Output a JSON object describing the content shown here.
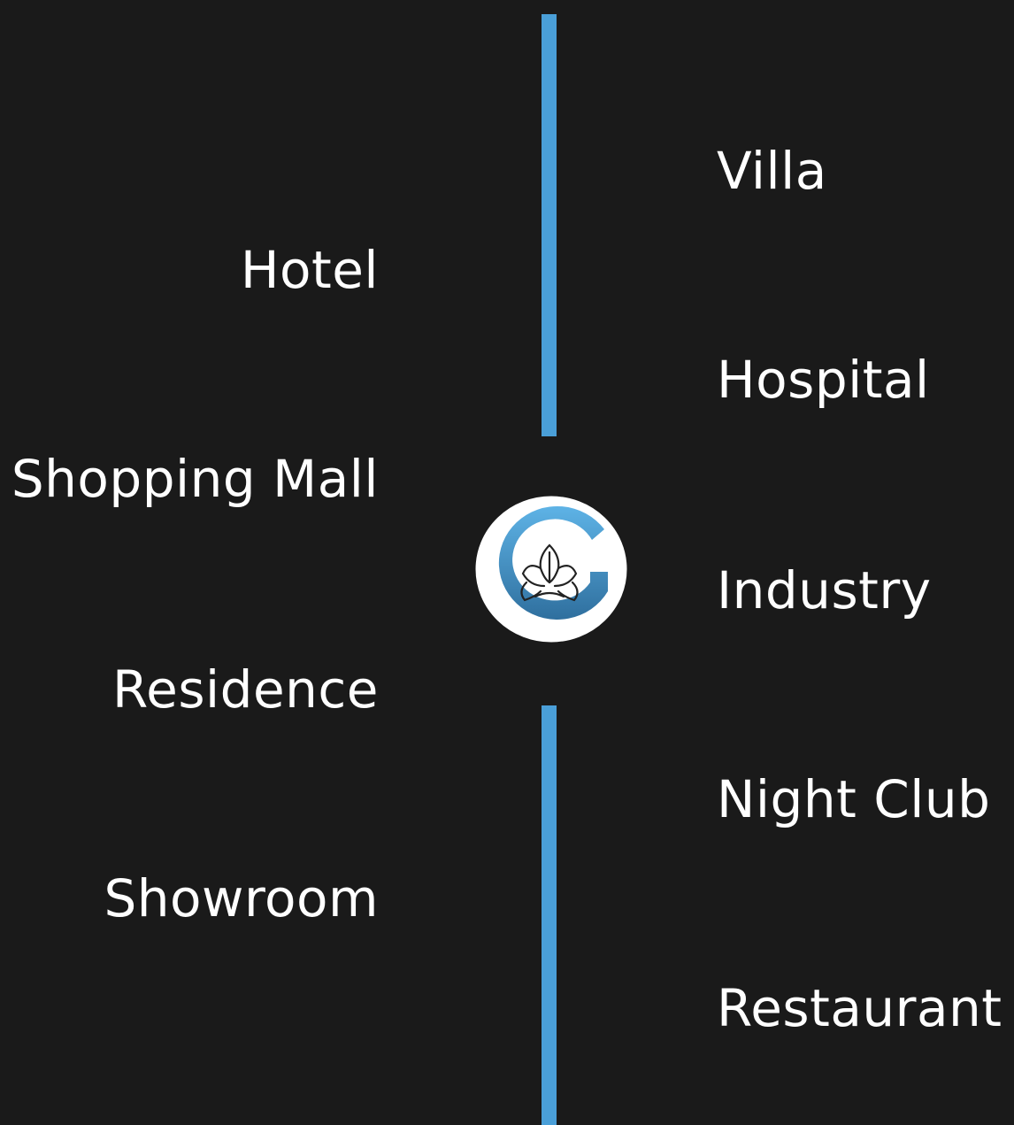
{
  "left_items": [
    {
      "label": "Hotel"
    },
    {
      "label": "Shopping Mall"
    },
    {
      "label": "Residence"
    },
    {
      "label": "Showroom"
    }
  ],
  "right_items": [
    {
      "label": "Villa"
    },
    {
      "label": "Hospital"
    },
    {
      "label": "Industry"
    },
    {
      "label": "Night Club"
    },
    {
      "label": "Restaurant"
    }
  ],
  "logo": {
    "icon": "g-lotus-logo-icon",
    "letter": "G"
  },
  "colors": {
    "background": "#1a1a1a",
    "accent": "#4a9fd8",
    "text": "#ffffff"
  }
}
